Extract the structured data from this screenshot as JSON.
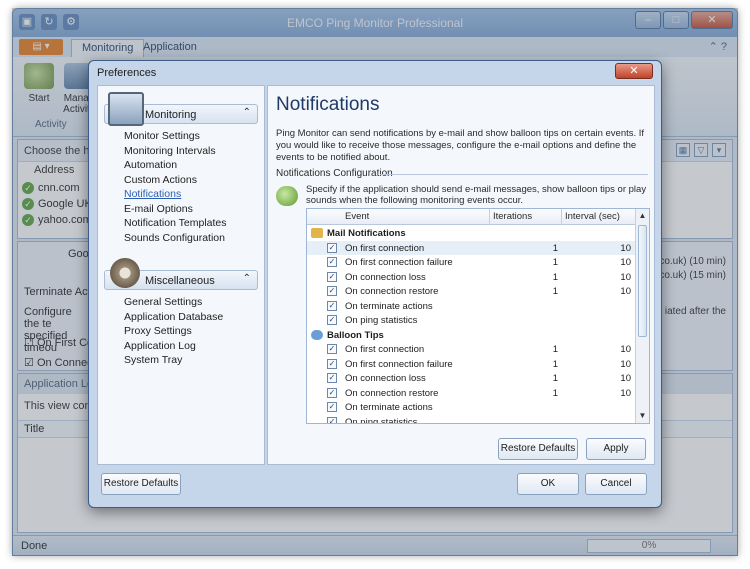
{
  "window": {
    "title": "EMCO Ping Monitor Professional"
  },
  "ribbon": {
    "tabs": [
      {
        "label": "Monitoring"
      },
      {
        "label": "Application"
      }
    ],
    "buttons": [
      {
        "label": "Start"
      },
      {
        "label": "Manag Activity"
      }
    ],
    "group_label": "Activity"
  },
  "hosts_panel": {
    "prompt": "Choose the hos",
    "column": "Address",
    "hosts": [
      {
        "name": "cnn.com"
      },
      {
        "name": "Google UK (g"
      },
      {
        "name": "yahoo.com"
      }
    ]
  },
  "detail_panel": {
    "host_label": "Google",
    "terminate_label": "Terminate Action",
    "configure_text": "Configure the te specified timeou",
    "on_first_label": "On First Con",
    "on_connection_label": "On Connecti",
    "right_log": [
      "co.uk) (10 min)",
      "co.uk) (15 min)"
    ],
    "right_note": "iated after the"
  },
  "app_log": {
    "title": "Application Log",
    "description": "This view conta",
    "column": "Title"
  },
  "statusbar": {
    "text": "Done",
    "progress_text": "0%",
    "progress": 0
  },
  "dialog": {
    "title": "Preferences",
    "nav": {
      "monitoring": {
        "label": "Monitoring",
        "items": [
          {
            "label": "Monitor Settings"
          },
          {
            "label": "Monitoring Intervals"
          },
          {
            "label": "Automation"
          },
          {
            "label": "Custom Actions"
          },
          {
            "label": "Notifications"
          },
          {
            "label": "E-mail Options"
          },
          {
            "label": "Notification Templates"
          },
          {
            "label": "Sounds Configuration"
          }
        ]
      },
      "misc": {
        "label": "Miscellaneous",
        "items": [
          {
            "label": "General Settings"
          },
          {
            "label": "Application Database"
          },
          {
            "label": "Proxy Settings"
          },
          {
            "label": "Application Log"
          },
          {
            "label": "System Tray"
          }
        ]
      }
    },
    "page": {
      "heading": "Notifications",
      "intro": "Ping Monitor can send notifications by e-mail and show balloon tips on certain events. If you would like to receive those messages, configure the e-mail options and define the events to be notified about.",
      "section_title": "Notifications Configuration",
      "section_desc": "Specify if the application should send e-mail messages, show balloon tips or play sounds when the following monitoring events occur.",
      "grid": {
        "columns": {
          "event": "Event",
          "iterations": "Iterations",
          "interval": "Interval (sec)"
        },
        "groups": [
          {
            "name": "Mail Notifications",
            "rows": [
              {
                "event": "On first connection",
                "checked": true,
                "iterations": "1",
                "interval": "10"
              },
              {
                "event": "On first connection failure",
                "checked": true,
                "iterations": "1",
                "interval": "10"
              },
              {
                "event": "On connection loss",
                "checked": true,
                "iterations": "1",
                "interval": "10"
              },
              {
                "event": "On connection restore",
                "checked": true,
                "iterations": "1",
                "interval": "10"
              },
              {
                "event": "On terminate actions",
                "checked": true,
                "iterations": "",
                "interval": ""
              },
              {
                "event": "On ping statistics",
                "checked": true,
                "iterations": "",
                "interval": ""
              }
            ]
          },
          {
            "name": "Balloon Tips",
            "rows": [
              {
                "event": "On first connection",
                "checked": true,
                "iterations": "1",
                "interval": "10"
              },
              {
                "event": "On first connection failure",
                "checked": true,
                "iterations": "1",
                "interval": "10"
              },
              {
                "event": "On connection loss",
                "checked": true,
                "iterations": "1",
                "interval": "10"
              },
              {
                "event": "On connection restore",
                "checked": true,
                "iterations": "1",
                "interval": "10"
              },
              {
                "event": "On terminate actions",
                "checked": true,
                "iterations": "",
                "interval": ""
              },
              {
                "event": "On ping statistics",
                "checked": true,
                "iterations": "",
                "interval": ""
              }
            ]
          }
        ]
      },
      "restore_defaults_label": "Restore Defaults",
      "apply_label": "Apply"
    },
    "footer": {
      "restore_defaults_label": "Restore Defaults",
      "ok_label": "OK",
      "cancel_label": "Cancel"
    }
  }
}
